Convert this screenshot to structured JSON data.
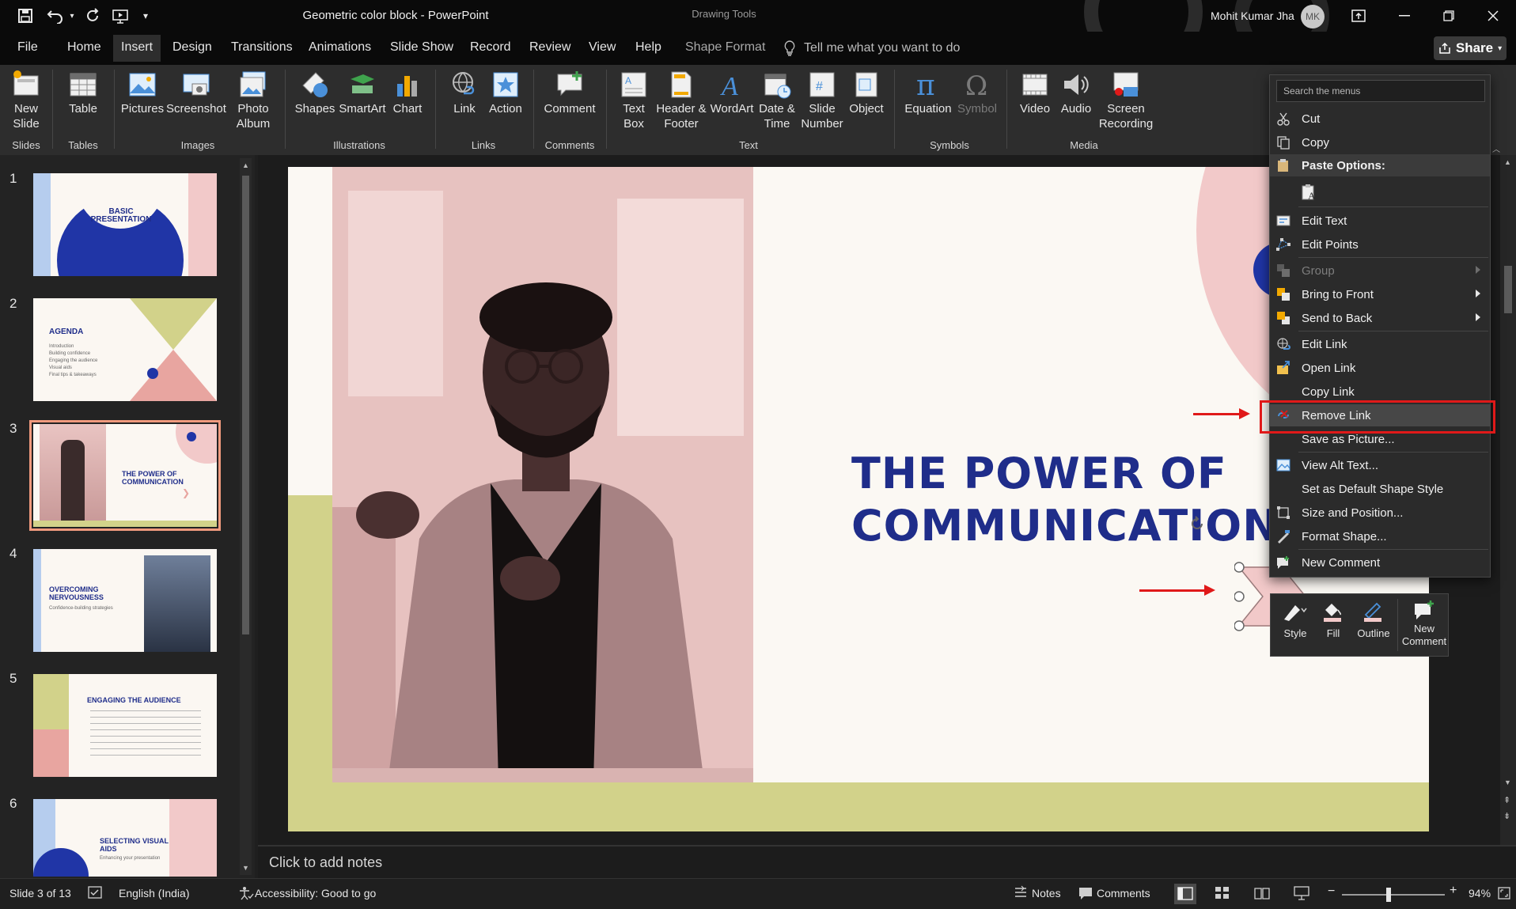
{
  "titlebar": {
    "doc_title": "Geometric color block  -  PowerPoint",
    "contextual_group": "Drawing Tools",
    "user_name": "Mohit Kumar Jha",
    "user_initials": "MK"
  },
  "tabs": [
    {
      "label": "File"
    },
    {
      "label": "Home"
    },
    {
      "label": "Insert"
    },
    {
      "label": "Design"
    },
    {
      "label": "Transitions"
    },
    {
      "label": "Animations"
    },
    {
      "label": "Slide Show"
    },
    {
      "label": "Record"
    },
    {
      "label": "Review"
    },
    {
      "label": "View"
    },
    {
      "label": "Help"
    },
    {
      "label": "Shape Format"
    }
  ],
  "tell_me": "Tell me what you want to do",
  "share_label": "Share",
  "ribbon": {
    "new_slide": "New Slide",
    "table": "Table",
    "pictures": "Pictures",
    "screenshot": "Screenshot",
    "photo_album": "Photo Album",
    "shapes": "Shapes",
    "smartart": "SmartArt",
    "chart": "Chart",
    "link": "Link",
    "action": "Action",
    "comment": "Comment",
    "text_box": "Text Box",
    "header_footer": "Header & Footer",
    "wordart": "WordArt",
    "date_time": "Date & Time",
    "slide_number": "Slide Number",
    "object": "Object",
    "equation": "Equation",
    "symbol": "Symbol",
    "video": "Video",
    "audio": "Audio",
    "screen_recording": "Screen Recording",
    "groups": {
      "slides": "Slides",
      "tables": "Tables",
      "images": "Images",
      "illustrations": "Illustrations",
      "links": "Links",
      "comments": "Comments",
      "text": "Text",
      "symbols": "Symbols",
      "media": "Media"
    }
  },
  "slides": [
    {
      "num": "1",
      "title": "BASIC PRESENTATION"
    },
    {
      "num": "2",
      "title": "AGENDA",
      "lines": [
        "Introduction",
        "Building confidence",
        "Engaging the audience",
        "Visual aids",
        "Final tips & takeaways"
      ]
    },
    {
      "num": "3",
      "title": "THE POWER OF COMMUNICATION"
    },
    {
      "num": "4",
      "title": "OVERCOMING NERVOUSNESS",
      "sub": "Confidence-building strategies"
    },
    {
      "num": "5",
      "title": "ENGAGING THE AUDIENCE"
    },
    {
      "num": "6",
      "title": "SELECTING VISUAL AIDS",
      "sub": "Enhancing your presentation"
    }
  ],
  "main_slide": {
    "title_line1": "THE POWER OF",
    "title_line2": "COMMUNICATION"
  },
  "notes_placeholder": "Click to add notes",
  "context_menu": {
    "search_placeholder": "Search the menus",
    "items": {
      "cut": "Cut",
      "copy": "Copy",
      "paste_options": "Paste Options:",
      "edit_text": "Edit Text",
      "edit_points": "Edit Points",
      "group": "Group",
      "bring_to_front": "Bring to Front",
      "send_to_back": "Send to Back",
      "edit_link": "Edit Link",
      "open_link": "Open Link",
      "copy_link": "Copy Link",
      "remove_link": "Remove Link",
      "save_as_picture": "Save as Picture...",
      "view_alt_text": "View Alt Text...",
      "set_default_shape_style": "Set as Default Shape Style",
      "size_and_position": "Size and Position...",
      "format_shape": "Format Shape...",
      "new_comment": "New Comment"
    }
  },
  "mini_toolbar": {
    "style": "Style",
    "fill": "Fill",
    "outline": "Outline",
    "new_comment": "New Comment"
  },
  "statusbar": {
    "slide_counter": "Slide 3 of 13",
    "language": "English (India)",
    "accessibility": "Accessibility: Good to go",
    "notes": "Notes",
    "comments": "Comments",
    "zoom": "94%"
  },
  "colors": {
    "slide_title_blue": "#1f2d8a",
    "olive": "#d2d28a",
    "pink": "#f2c9c9",
    "annotation_red": "#e01919"
  }
}
